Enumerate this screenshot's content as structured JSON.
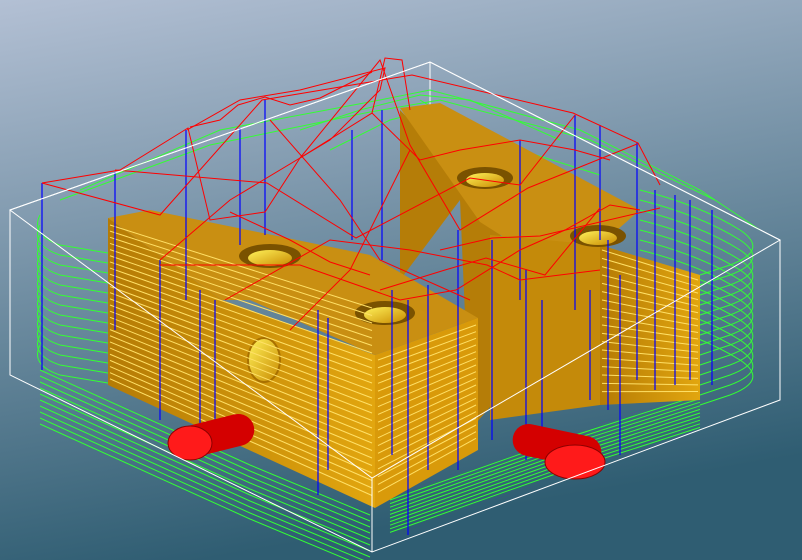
{
  "viewport": {
    "background_top": "#b3c0d4",
    "background_bottom": "#2f5d72"
  },
  "scene": {
    "stock_box_color": "#ffffff",
    "part_color": "#d99a0a",
    "part_top_color": "#c98f12",
    "toolpath_cut_color": "#33ff33",
    "rapid_move_color": "#ff0000",
    "plunge_move_color": "#0000ff",
    "clamp_color": "#d40000",
    "layer_line_color": "#ffe066"
  }
}
